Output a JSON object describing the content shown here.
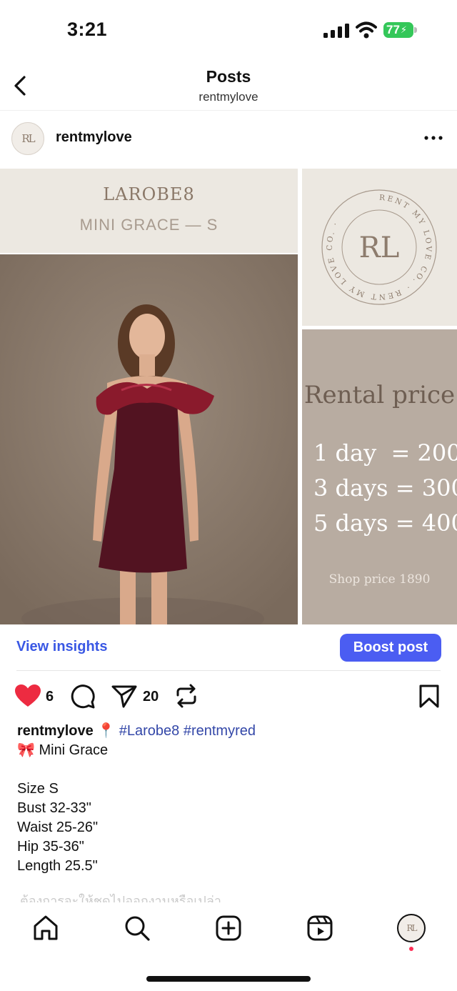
{
  "status_bar": {
    "time": "3:21",
    "battery": "77"
  },
  "header": {
    "title": "Posts",
    "subtitle": "rentmylove"
  },
  "post": {
    "author": "rentmylove",
    "image": {
      "brand": "LAROBE8",
      "model": "MINI GRACE — S",
      "logo_monogram": "RL",
      "logo_ring_text": "RENT MY LOVE CO. · RENT MY LOVE CO. ·",
      "price_title": "Rental price",
      "prices": [
        "1 day  = 200",
        "3 days = 300",
        "5 days = 400"
      ],
      "shop_price": "Shop price 1890"
    },
    "insights_label": "View insights",
    "boost_label": "Boost post",
    "likes": "6",
    "shares": "20",
    "caption": {
      "user": "rentmylove",
      "pin": "📍",
      "tags": "#Larobe8 #rentmyred",
      "line1": "🎀 Mini Grace",
      "details": [
        "Size S",
        "Bust 32-33\"",
        "Waist 25-26\"",
        "Hip 35-36\"",
        "Length 25.5\""
      ],
      "truncated": "ต้องการจะให้ชุดไปออกงานหรือเปล่า"
    }
  },
  "icons": {
    "back": "chevron-left-icon",
    "more": "more-horizontal-icon",
    "like": "heart-icon",
    "comment": "comment-icon",
    "share": "send-icon",
    "repost": "repost-icon",
    "save": "bookmark-icon",
    "home": "home-icon",
    "search": "search-icon",
    "create": "plus-square-icon",
    "reels": "reels-icon"
  },
  "colors": {
    "accent": "#4b5df2",
    "link": "#3a58e4",
    "like": "#ed2b41",
    "hashtag": "#3347a8"
  }
}
